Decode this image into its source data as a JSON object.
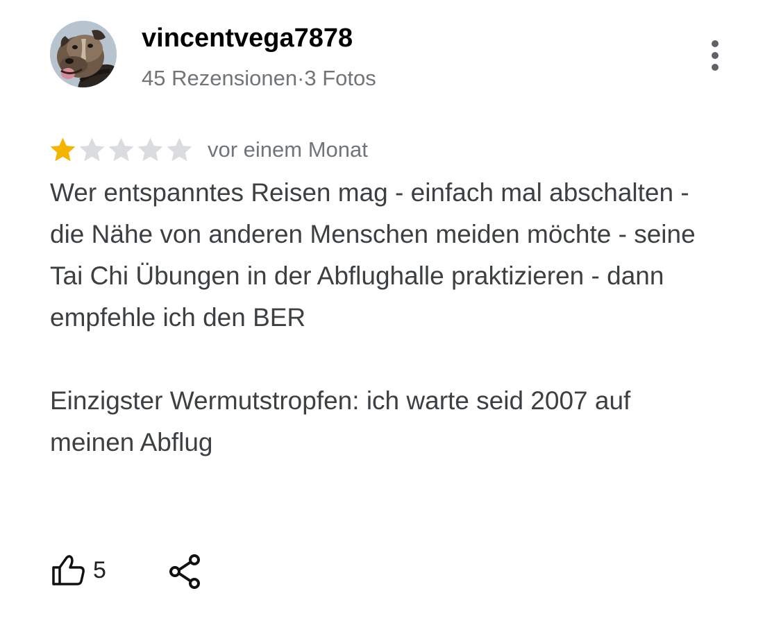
{
  "reviewer": {
    "name": "vincentvega7878",
    "stats": "45 Rezensionen·3 Fotos",
    "avatar_icon": "dog-photo-avatar"
  },
  "menu": {
    "icon": "more-vertical-icon"
  },
  "rating": {
    "stars": 1,
    "max": 5,
    "filled_color": "#f4b400",
    "empty_color": "#dadce0",
    "date": "vor einem Monat"
  },
  "review": {
    "paragraphs": [
      "Wer entspanntes Reisen mag -  einfach mal abschalten - die Nähe von anderen Menschen meiden möchte - seine Tai Chi Übungen in der Abflughalle praktizieren - dann empfehle ich den BER",
      "Einzigster Wermutstropfen: ich warte seid 2007 auf meinen Abflug"
    ]
  },
  "actions": {
    "like_icon": "thumbs-up-icon",
    "like_count": "5",
    "share_icon": "share-icon"
  }
}
